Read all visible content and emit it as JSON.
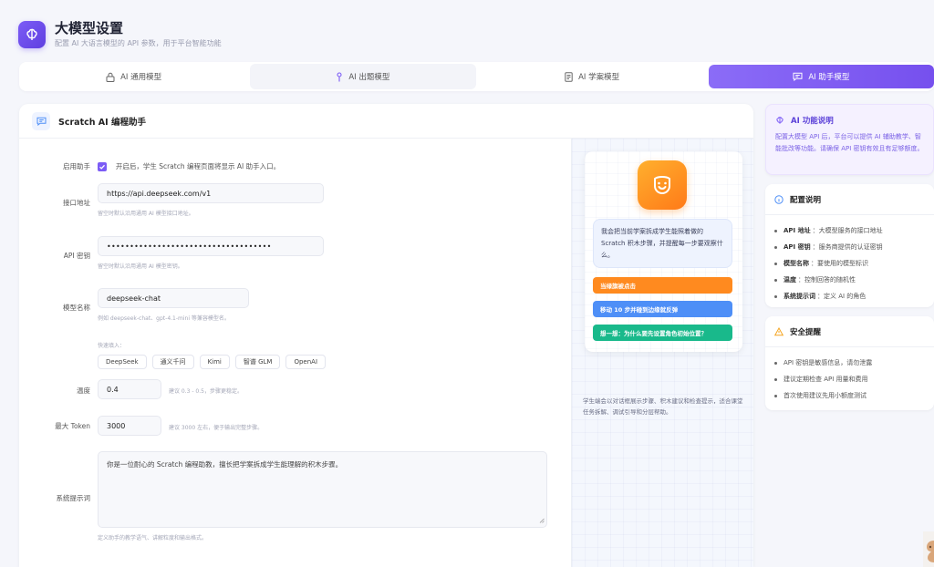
{
  "header": {
    "title": "大模型设置",
    "subtitle": "配置 AI 大语言模型的 API 参数，用于平台智能功能"
  },
  "tabs": [
    {
      "label": "AI 通用模型",
      "icon": "lock-icon"
    },
    {
      "label": "AI 出题模型",
      "icon": "pin-icon"
    },
    {
      "label": "AI 学案模型",
      "icon": "document-icon"
    },
    {
      "label": "AI 助手模型",
      "icon": "chat-icon"
    }
  ],
  "active_tab": 3,
  "colors": {
    "accent": "#7c5cf6",
    "orange": "#ff8a1f",
    "blue": "#4e8ff7",
    "green": "#19b98b"
  },
  "card": {
    "title": "Scratch AI 编程助手"
  },
  "form": {
    "enable": {
      "label": "启用助手",
      "text": "开启后，学生 Scratch 编程页面将显示 AI 助手入口。",
      "checked": true
    },
    "endpoint": {
      "label": "接口地址",
      "value": "https://api.deepseek.com/v1",
      "hint": "留空时默认沿用通用 AI 模型接口地址。"
    },
    "api_key": {
      "label": "API 密钥",
      "value": "••••••••••••••••••••••••••••••••••••",
      "hint": "留空时默认沿用通用 AI 模型密钥。"
    },
    "model": {
      "label": "模型名称",
      "value": "deepseek-chat",
      "hint": "例如 deepseek-chat、gpt-4.1-mini 等兼容模型名。"
    },
    "quick": {
      "label": "快速填入：",
      "options": [
        "DeepSeek",
        "通义千问",
        "Kimi",
        "智谱 GLM",
        "OpenAI"
      ]
    },
    "temperature": {
      "label": "温度",
      "value": "0.4",
      "hint": "建议 0.3 - 0.5，步骤更稳定。"
    },
    "max_token": {
      "label": "最大 Token",
      "value": "3000",
      "hint": "建议 3000 左右，便于输出完整步骤。"
    },
    "system_prompt": {
      "label": "系统提示词",
      "value": "你是一位耐心的 Scratch 编程助教，擅长把学案拆成学生能理解的积木步骤。",
      "hint": "定义助手的教学语气、讲解粒度和输出格式。"
    }
  },
  "preview": {
    "bubble": "我会把当前学案拆成学生能照着做的 Scratch 积木步骤，并提醒每一步要观察什么。",
    "steps": [
      {
        "text": "当绿旗被点击",
        "color": "#ff8a1f"
      },
      {
        "text": "移动 10 步并碰到边缘就反弹",
        "color": "#4e8ff7"
      },
      {
        "text": "想一想：为什么要先设置角色初始位置？",
        "color": "#19b98b"
      }
    ],
    "desc": "学生端会以对话框展示步骤、积木建议和检查提示，适合课堂任务拆解、调试引导和分层帮助。"
  },
  "sidebar": {
    "features": {
      "title": "AI 功能说明",
      "text": "配置大模型 API 后，平台可以提供 AI 辅助教学、智能批改等功能。请确保 API 密钥有效且有足够额度。"
    },
    "config": {
      "title": "配置说明",
      "items": [
        {
          "key": "API 地址",
          "desc": "：大模型服务的接口地址"
        },
        {
          "key": "API 密钥",
          "desc": "：服务商提供的认证密钥"
        },
        {
          "key": "模型名称",
          "desc": "：要使用的模型标识"
        },
        {
          "key": "温度",
          "desc": "：控制回答的随机性"
        },
        {
          "key": "系统提示词",
          "desc": "：定义 AI 的角色"
        }
      ]
    },
    "security": {
      "title": "安全提醒",
      "items": [
        "API 密钥是敏感信息，请勿泄露",
        "建议定期检查 API 用量和费用",
        "首次使用建议先用小额度测试"
      ]
    }
  }
}
